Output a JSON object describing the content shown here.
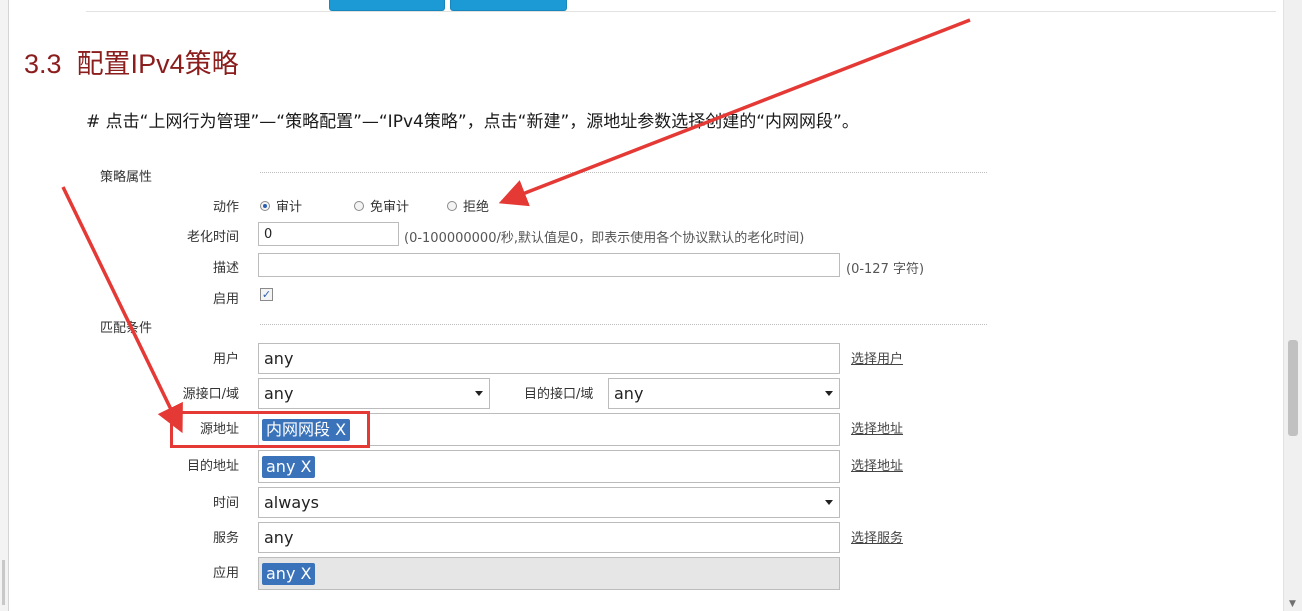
{
  "section": {
    "number": "3.3",
    "title": "配置IPv4策略"
  },
  "instruction": "# 点击“上网行为管理”—“策略配置”—“IPv4策略”，点击“新建”，源地址参数选择创建的“内网网段”。",
  "form": {
    "group_policy": "策略属性",
    "group_match": "匹配条件",
    "action": {
      "label": "动作",
      "options": [
        "审计",
        "免审计",
        "拒绝"
      ],
      "selected": "审计"
    },
    "aging": {
      "label": "老化时间",
      "value": "0",
      "hint": "(0-100000000/秒,默认值是0，即表示使用各个协议默认的老化时间)"
    },
    "description": {
      "label": "描述",
      "value": "",
      "hint": "(0-127 字符)"
    },
    "enable": {
      "label": "启用",
      "checked": true,
      "check_glyph": "✓"
    },
    "user": {
      "label": "用户",
      "value": "any",
      "link": "选择用户"
    },
    "src_intf": {
      "label": "源接口/域",
      "value": "any"
    },
    "dst_intf": {
      "label": "目的接口/域",
      "value": "any"
    },
    "src_addr": {
      "label": "源地址",
      "tag": "内网网段 X",
      "link": "选择地址"
    },
    "dst_addr": {
      "label": "目的地址",
      "tag": "any X",
      "link": "选择地址"
    },
    "schedule": {
      "label": "时间",
      "value": "always"
    },
    "service": {
      "label": "服务",
      "value": "any",
      "link": "选择服务"
    },
    "application": {
      "label": "应用",
      "tag": "any X"
    }
  },
  "annotation": {
    "color": "#e53935"
  },
  "colors": {
    "title": "#8b1d1d",
    "tag_bg": "#3b73ba",
    "button": "#1b9ad6"
  }
}
